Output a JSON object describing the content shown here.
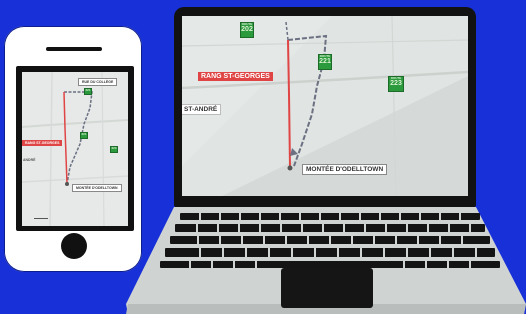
{
  "phone": {
    "labels": {
      "top": "RUE DU COLLÈGE",
      "red": "RANG ST-GEORGES",
      "left": "ANDRÉ",
      "bottom": "MONTÉE D'ODELLTOWN"
    },
    "shields": [
      "221",
      "221",
      "223"
    ]
  },
  "laptop": {
    "labels": {
      "red": "RANG ST-GEORGES",
      "left": "ST-ANDRÉ",
      "bottom": "MONTÉE D'ODELLTOWN"
    },
    "shields": {
      "top": "202",
      "middle": "221",
      "right": "223"
    },
    "shield_captions": {
      "top": "ROUTE",
      "middle": "ROUTE",
      "right": "ROUTE"
    }
  },
  "colors": {
    "background": "#1730d8",
    "route_red": "#e04545",
    "route_gray": "#6b7082",
    "shield_green": "#2b9a3d"
  }
}
